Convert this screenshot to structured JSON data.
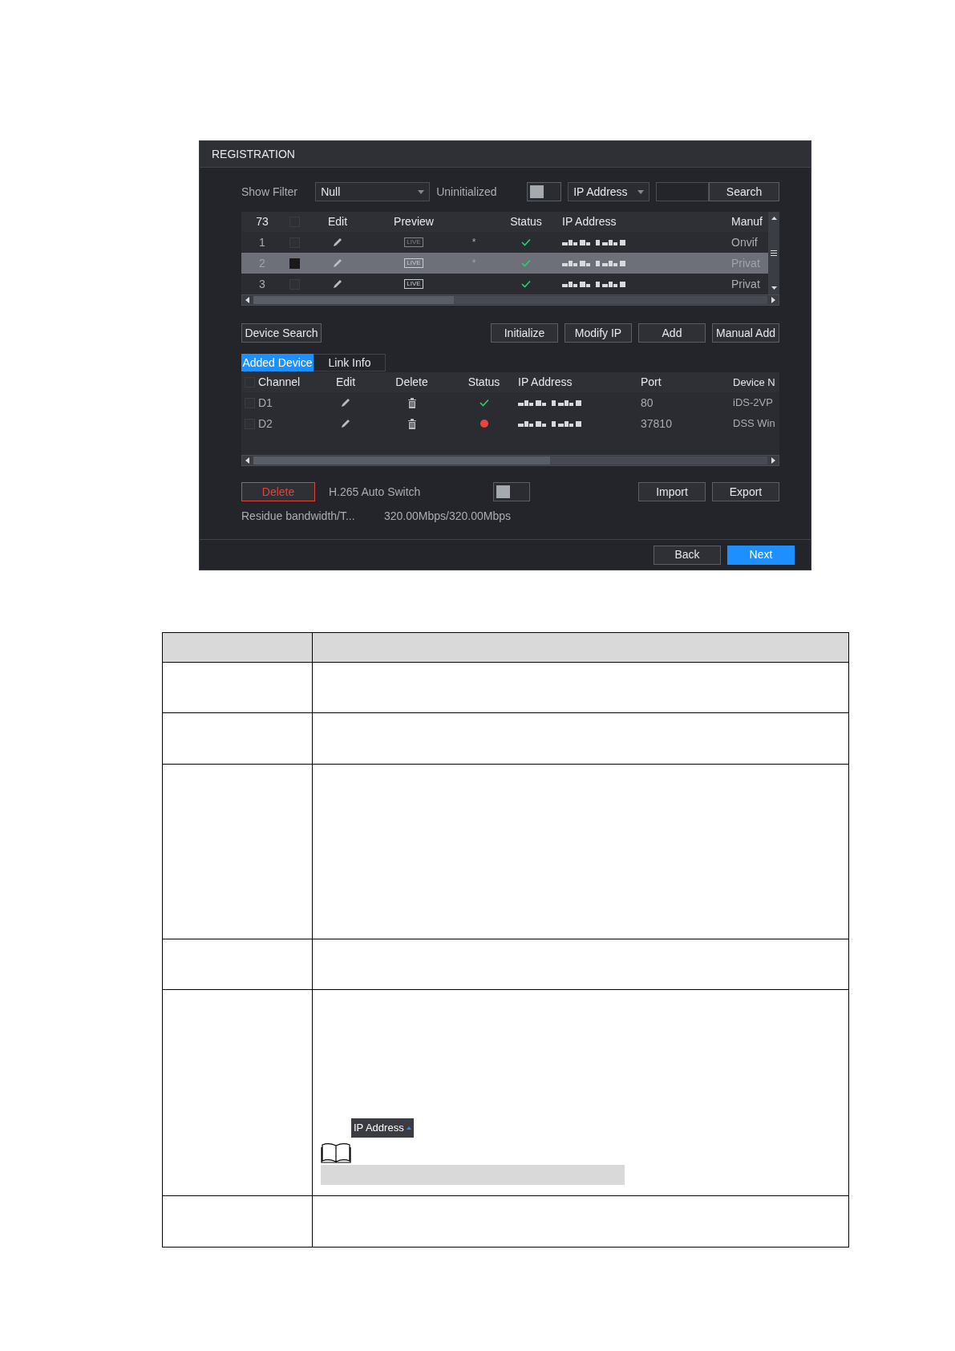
{
  "dialog": {
    "title": "REGISTRATION",
    "filter": {
      "label": "Show Filter",
      "value": "Null",
      "toggle_label": "Uninitialized",
      "toggle_on": false,
      "search_by": "IP Address",
      "search_button": "Search"
    },
    "search_table": {
      "all_checked": false,
      "columns": [
        "73",
        "Edit",
        "Preview",
        "Status",
        "IP Address",
        "Manuf"
      ],
      "rows": [
        {
          "index": "1",
          "selected": false,
          "preview": "LIVE",
          "preview_disabled": true,
          "mark": "*",
          "manufacturer": "Onvif"
        },
        {
          "index": "2",
          "selected": true,
          "preview": "LIVE",
          "preview_disabled": false,
          "mark": "*",
          "manufacturer": "Privat"
        },
        {
          "index": "3",
          "selected": false,
          "preview": "LIVE",
          "preview_disabled": false,
          "mark": "",
          "manufacturer": "Privat"
        }
      ]
    },
    "actions": {
      "left": "Device Search",
      "right": [
        "Initialize",
        "Modify IP",
        "Add",
        "Manual Add"
      ]
    },
    "tabs": [
      {
        "label": "Added Device",
        "selected": true
      },
      {
        "label": "Link Info",
        "selected": false
      }
    ],
    "added_table": {
      "all_checked": false,
      "columns": [
        "Channel",
        "Edit",
        "Delete",
        "Status",
        "IP Address",
        "Port",
        "Device N"
      ],
      "rows": [
        {
          "channel": "D1",
          "checked": false,
          "online": true,
          "port": "80",
          "device_name": "iDS-2VP"
        },
        {
          "channel": "D2",
          "checked": false,
          "online": false,
          "port": "37810",
          "device_name": "DSS Win"
        }
      ]
    },
    "bottom": {
      "delete_button": "Delete",
      "h265_label": "H.265 Auto Switch",
      "h265_on": false,
      "import_button": "Import",
      "export_button": "Export",
      "bandwidth_label": "Residue bandwidth/T...",
      "bandwidth_value": "320.00Mbps/320.00Mbps"
    },
    "footer": {
      "back_button": "Back",
      "next_button": "Next"
    }
  },
  "doc_table": {
    "inline_sort_label": "IP Address"
  }
}
